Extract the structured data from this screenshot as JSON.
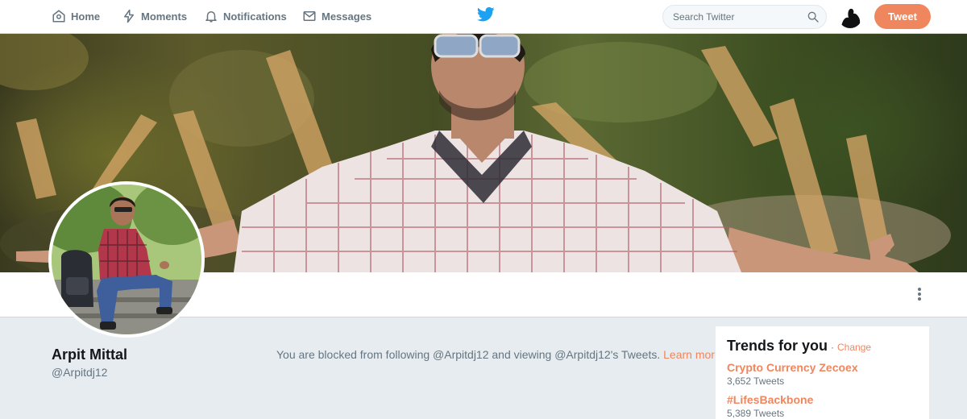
{
  "nav": {
    "home": "Home",
    "moments": "Moments",
    "notifications": "Notifications",
    "messages": "Messages",
    "icons": [
      "home-icon",
      "lightning-icon",
      "bell-icon",
      "envelope-icon"
    ]
  },
  "search": {
    "placeholder": "Search Twitter"
  },
  "tweet_button": "Tweet",
  "profile": {
    "name": "Arpit Mittal",
    "handle": "@Arpitdj12",
    "blocked_message": "You are blocked from following @Arpitdj12 and viewing @Arpitdj12's Tweets.",
    "learn_more": "Learn more"
  },
  "trends": {
    "title": "Trends for you",
    "separator": "·",
    "change": "Change",
    "items": [
      {
        "name": "Crypto Currency Zecoex",
        "count": "3,652 Tweets"
      },
      {
        "name": "#LifesBackbone",
        "count": "5,389 Tweets"
      }
    ]
  },
  "colors": {
    "accent": "#f0865e",
    "twitter_blue": "#1da1f2",
    "muted": "#66757f",
    "background": "#e6ecf0"
  }
}
